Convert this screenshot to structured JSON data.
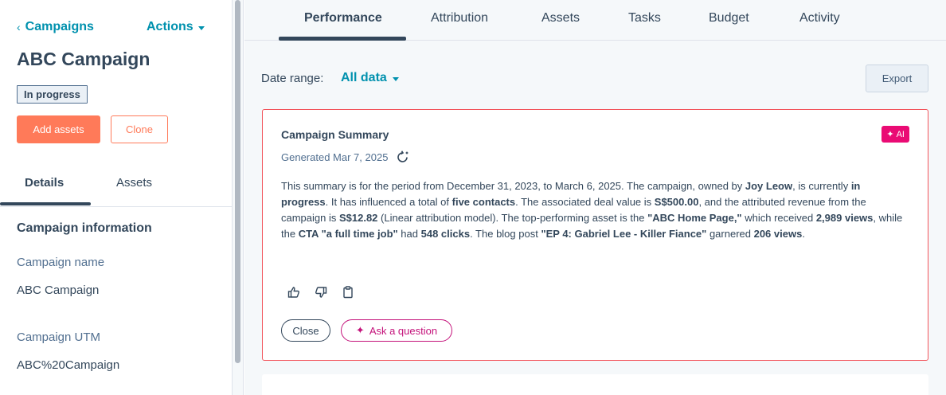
{
  "sidebar": {
    "back_label": "Campaigns",
    "actions_label": "Actions",
    "campaign_title": "ABC Campaign",
    "status": "In progress",
    "add_assets_label": "Add assets",
    "clone_label": "Clone",
    "tabs": [
      {
        "label": "Details",
        "active": true
      },
      {
        "label": "Assets",
        "active": false
      }
    ],
    "section_heading": "Campaign information",
    "fields": [
      {
        "label": "Campaign name",
        "value": "ABC Campaign"
      },
      {
        "label": "Campaign UTM",
        "value": "ABC%20Campaign"
      }
    ]
  },
  "main": {
    "tabs": [
      {
        "label": "Performance",
        "active": true
      },
      {
        "label": "Attribution",
        "active": false
      },
      {
        "label": "Assets",
        "active": false
      },
      {
        "label": "Tasks",
        "active": false
      },
      {
        "label": "Budget",
        "active": false
      },
      {
        "label": "Activity",
        "active": false
      }
    ],
    "date_range_label": "Date range:",
    "date_range_value": "All data",
    "export_label": "Export"
  },
  "summary": {
    "title": "Campaign Summary",
    "ai_badge": "AI",
    "generated": "Generated Mar 7, 2025",
    "text_parts": [
      {
        "t": "This summary is for the period from December 31, 2023, to March 6, 2025. The campaign, owned by ",
        "b": false
      },
      {
        "t": "Joy Leow",
        "b": true
      },
      {
        "t": ", is currently ",
        "b": false
      },
      {
        "t": "in progress",
        "b": true
      },
      {
        "t": ". It has influenced a total of ",
        "b": false
      },
      {
        "t": "five contacts",
        "b": true
      },
      {
        "t": ". The associated deal value is ",
        "b": false
      },
      {
        "t": "S$500.00",
        "b": true
      },
      {
        "t": ", and the attributed revenue from the campaign is ",
        "b": false
      },
      {
        "t": "S$12.82",
        "b": true
      },
      {
        "t": " (Linear attribution model). The top-performing asset is the ",
        "b": false
      },
      {
        "t": "\"ABC Home Page,\"",
        "b": true
      },
      {
        "t": " which received ",
        "b": false
      },
      {
        "t": "2,989 views",
        "b": true
      },
      {
        "t": ", while the ",
        "b": false
      },
      {
        "t": "CTA \"a full time job\"",
        "b": true
      },
      {
        "t": " had ",
        "b": false
      },
      {
        "t": "548 clicks",
        "b": true
      },
      {
        "t": ". The blog post ",
        "b": false
      },
      {
        "t": "\"EP 4: Gabriel Lee - Killer Fiance\"",
        "b": true
      },
      {
        "t": " garnered ",
        "b": false
      },
      {
        "t": "206 views",
        "b": true
      },
      {
        "t": ".",
        "b": false
      }
    ],
    "close_label": "Close",
    "ask_label": "Ask a question"
  },
  "colors": {
    "link": "#0091ae",
    "primary_button": "#ff7a59",
    "ai_badge": "#ea0b74",
    "card_border": "#f2545b",
    "text": "#33475b"
  }
}
